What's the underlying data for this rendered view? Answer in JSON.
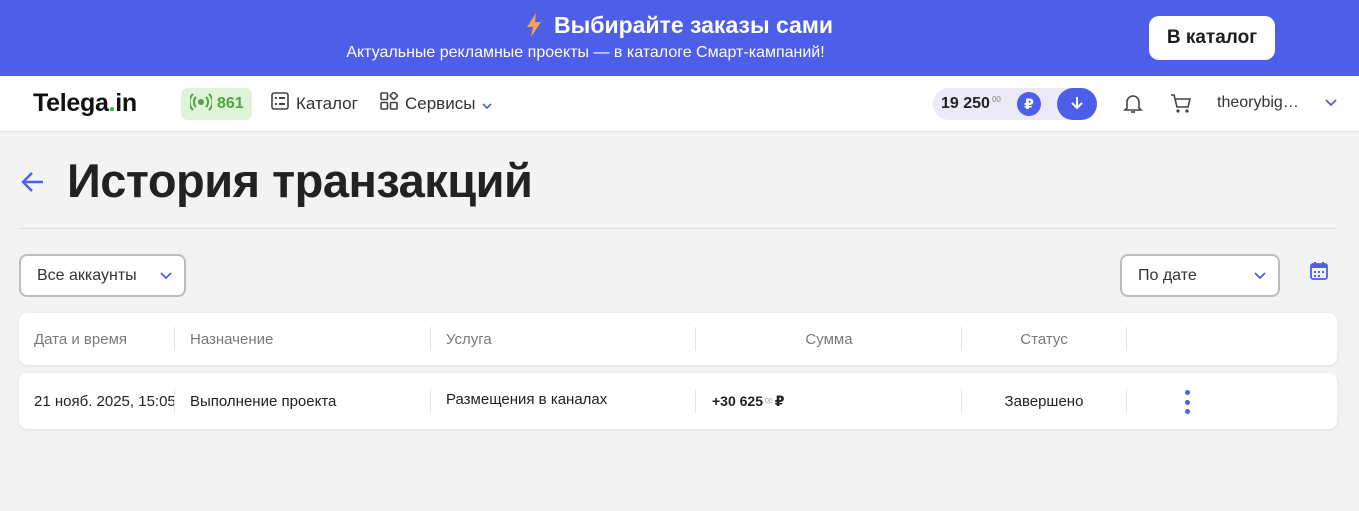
{
  "banner": {
    "title": "Выбирайте заказы сами",
    "subtitle": "Актуальные рекламные проекты — в каталоге Смарт-кампаний!",
    "button_label": "В каталог"
  },
  "header": {
    "logo_main": "Telega",
    "logo_dot": ".",
    "logo_tail": "in",
    "online_count": "861",
    "nav": {
      "catalog": "Каталог",
      "services": "Сервисы"
    },
    "balance": {
      "amount": "19 250",
      "cents": "00",
      "currency": "₽"
    },
    "user_name": "theorybigstar"
  },
  "page": {
    "title": "История транзакций"
  },
  "filters": {
    "accounts": "Все аккаунты",
    "sort": "По дате"
  },
  "table": {
    "columns": {
      "date": "Дата и время",
      "purpose": "Назначение",
      "service": "Услуга",
      "amount": "Сумма",
      "status": "Статус"
    },
    "rows": [
      {
        "date": "21 нояб. 2025, 15:05",
        "purpose": "Выполнение проекта",
        "service": "Размещения в каналах",
        "amount": "+30 625",
        "amount_cents": "00",
        "currency": "₽",
        "status": "Завершено"
      }
    ]
  },
  "colors": {
    "accent": "#4d5ee8",
    "online_green": "#4aa83a",
    "logo_dot": "#3fae3f"
  },
  "icons": [
    "lightning-icon",
    "broadcast-icon",
    "catalog-icon",
    "services-icon",
    "chevron-down-icon",
    "ruble-icon",
    "arrow-down-icon",
    "bell-icon",
    "cart-icon",
    "back-arrow-icon",
    "calendar-icon",
    "more-vertical-icon"
  ]
}
